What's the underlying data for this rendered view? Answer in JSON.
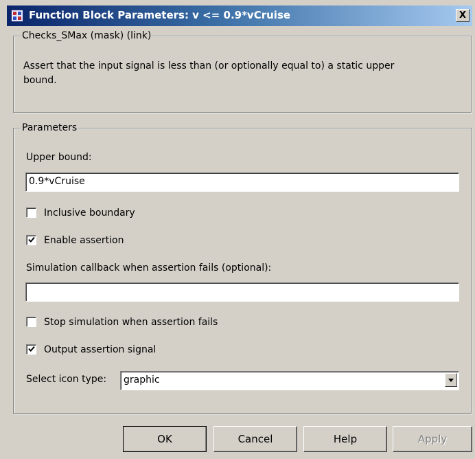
{
  "window": {
    "title": "Function Block Parameters: v <= 0.9*vCruise",
    "close_glyph": "X"
  },
  "description_group": {
    "legend": "Checks_SMax (mask) (link)",
    "line1": "Assert that the input signal is less than (or optionally equal to) a static upper",
    "line2": "bound."
  },
  "parameters_group": {
    "legend": "Parameters",
    "upper_bound_label": "Upper bound:",
    "upper_bound_value": "0.9*vCruise",
    "inclusive_label": "Inclusive boundary",
    "inclusive_checked": false,
    "enable_label": "Enable assertion",
    "enable_checked": true,
    "callback_label": "Simulation callback when assertion fails (optional):",
    "callback_value": "",
    "stop_label": "Stop simulation when assertion fails",
    "stop_checked": false,
    "output_label": "Output assertion signal",
    "output_checked": true,
    "icon_type_label": "Select icon type:",
    "icon_type_value": "graphic"
  },
  "buttons": {
    "ok": "OK",
    "cancel": "Cancel",
    "help": "Help",
    "apply": "Apply"
  },
  "icons": {
    "app_icon": "simulink-block-icon",
    "check_icon": "checkmark-icon",
    "dropdown_icon": "chevron-down-icon"
  }
}
